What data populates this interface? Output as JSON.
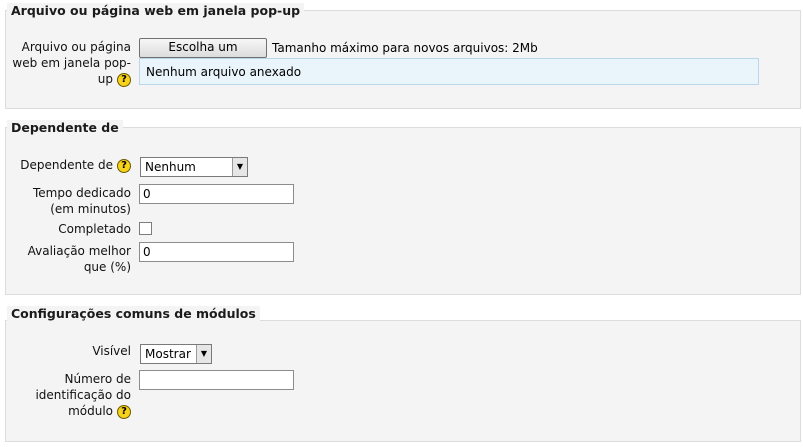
{
  "section1": {
    "legend": "Arquivo ou página web em janela pop-up",
    "label": [
      "Arquivo ou página",
      "web em janela pop-",
      "up"
    ],
    "button": "Escolha um arquivo...",
    "max_size": "Tamanho máximo para novos arquivos: 2Mb",
    "file_status": "Nenhum arquivo anexado"
  },
  "section2": {
    "legend": "Dependente de",
    "dependente_label": "Dependente de",
    "dependente_value": "Nenhum",
    "tempo_label": [
      "Tempo dedicado",
      "(em minutos)"
    ],
    "tempo_value": "0",
    "completado_label": "Completado",
    "avaliacao_label": [
      "Avaliação melhor",
      "que (%)"
    ],
    "avaliacao_value": "0"
  },
  "section3": {
    "legend": "Configurações comuns de módulos",
    "visivel_label": "Visível",
    "visivel_value": "Mostrar",
    "numero_label": [
      "Número de",
      "identificação do",
      "módulo"
    ],
    "numero_value": ""
  },
  "icons": {
    "help": "help-icon",
    "dropdown": "chevron-down-icon"
  },
  "colors": {
    "fieldset_bg": "#f4f4f4",
    "file_area_bg": "#eaf4fb",
    "help_icon": "#f6d21b"
  }
}
